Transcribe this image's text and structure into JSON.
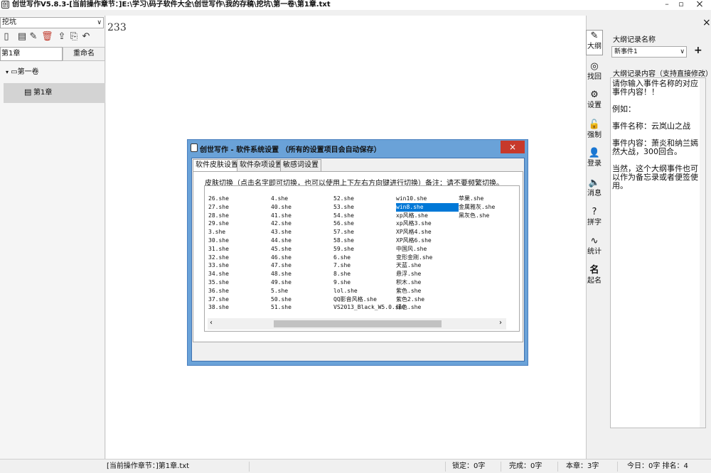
{
  "window": {
    "title": "创世写作V5.8.3-[当前操作章节：]E:\\学习\\码子软件大全\\创世写作\\我的存稿\\挖坑\\第一卷\\第1章.txt",
    "minimize": "–",
    "restore": "▫",
    "close": "×"
  },
  "left": {
    "book_select": "挖坑",
    "chapter_input": "第1章",
    "rename_label": "重命名",
    "tree_volume": "第一卷",
    "tree_chapter": "第1章"
  },
  "editor": {
    "text": "233"
  },
  "iconbar": [
    {
      "icon": "edit",
      "label": "大纲"
    },
    {
      "icon": "recover",
      "label": "找回"
    },
    {
      "icon": "gear",
      "label": "设置"
    },
    {
      "icon": "lock",
      "label": "强制"
    },
    {
      "icon": "user",
      "label": "登录"
    },
    {
      "icon": "speaker",
      "label": "消息"
    },
    {
      "icon": "spell",
      "label": "拼字"
    },
    {
      "icon": "chart",
      "label": "统计"
    },
    {
      "icon": "name",
      "label": "起名"
    }
  ],
  "outline": {
    "name_label": "大纲记录名称",
    "select_value": "新事件1",
    "add_label": "+",
    "close_label": "×",
    "content_label": "大纲记录内容（支持直接修改）",
    "content_paragraphs": [
      "请你输入事件名称的对应事件内容！！",
      "例如：",
      "事件名称：云岚山之战",
      "事件内容：萧炎和纳兰嫣然大战，300回合。",
      "当然，这个大纲事件也可以作为备忘录或者便签使用。"
    ]
  },
  "statusbar": {
    "current": "[当前操作章节：]第1章.txt",
    "locked": "锁定：0字",
    "done": "完成：0字",
    "chapter": "本章：3字",
    "today": "今日：0字  排名：4"
  },
  "dialog": {
    "title": "创世写作 - 软件系统设置 （所有的设置项目会自动保存）",
    "close": "×",
    "tabs": [
      "软件皮肤设置",
      "软件杂项设置",
      "敏感词设置"
    ],
    "hint": "皮肤切换（点击名字即可切换，也可以使用上下左右方向键进行切换）备注：请不要频繁切换。",
    "selected_skin": "win8.she",
    "columns": [
      [
        "26.she",
        "27.she",
        "28.she",
        "29.she",
        "3.she",
        "30.she",
        "31.she",
        "32.she",
        "33.she",
        "34.she",
        "35.she",
        "36.she",
        "37.she",
        "38.she"
      ],
      [
        "4.she",
        "40.she",
        "41.she",
        "42.she",
        "43.she",
        "44.she",
        "45.she",
        "46.she",
        "47.she",
        "48.she",
        "49.she",
        "5.she",
        "50.she",
        "51.she"
      ],
      [
        "52.she",
        "53.she",
        "54.she",
        "56.she",
        "57.she",
        "58.she",
        "59.she",
        "6.she",
        "7.she",
        "8.she",
        "9.she",
        "lol.she",
        "QQ影音风格.she",
        "VS2013_Black_W5.0.she"
      ],
      [
        "win10.she",
        "win8.she",
        "xp风格.she",
        "xp风格3.she",
        "XP风格4.she",
        "XP风格6.she",
        "中国风.she",
        "变形金刚.she",
        "天蓝.she",
        "悬浮.she",
        "积木.she",
        "紫色.she",
        "紫色2.she",
        "绿色.she"
      ],
      [
        "苹果.she",
        "金属雅灰.she",
        "黑灰色.she"
      ]
    ]
  }
}
